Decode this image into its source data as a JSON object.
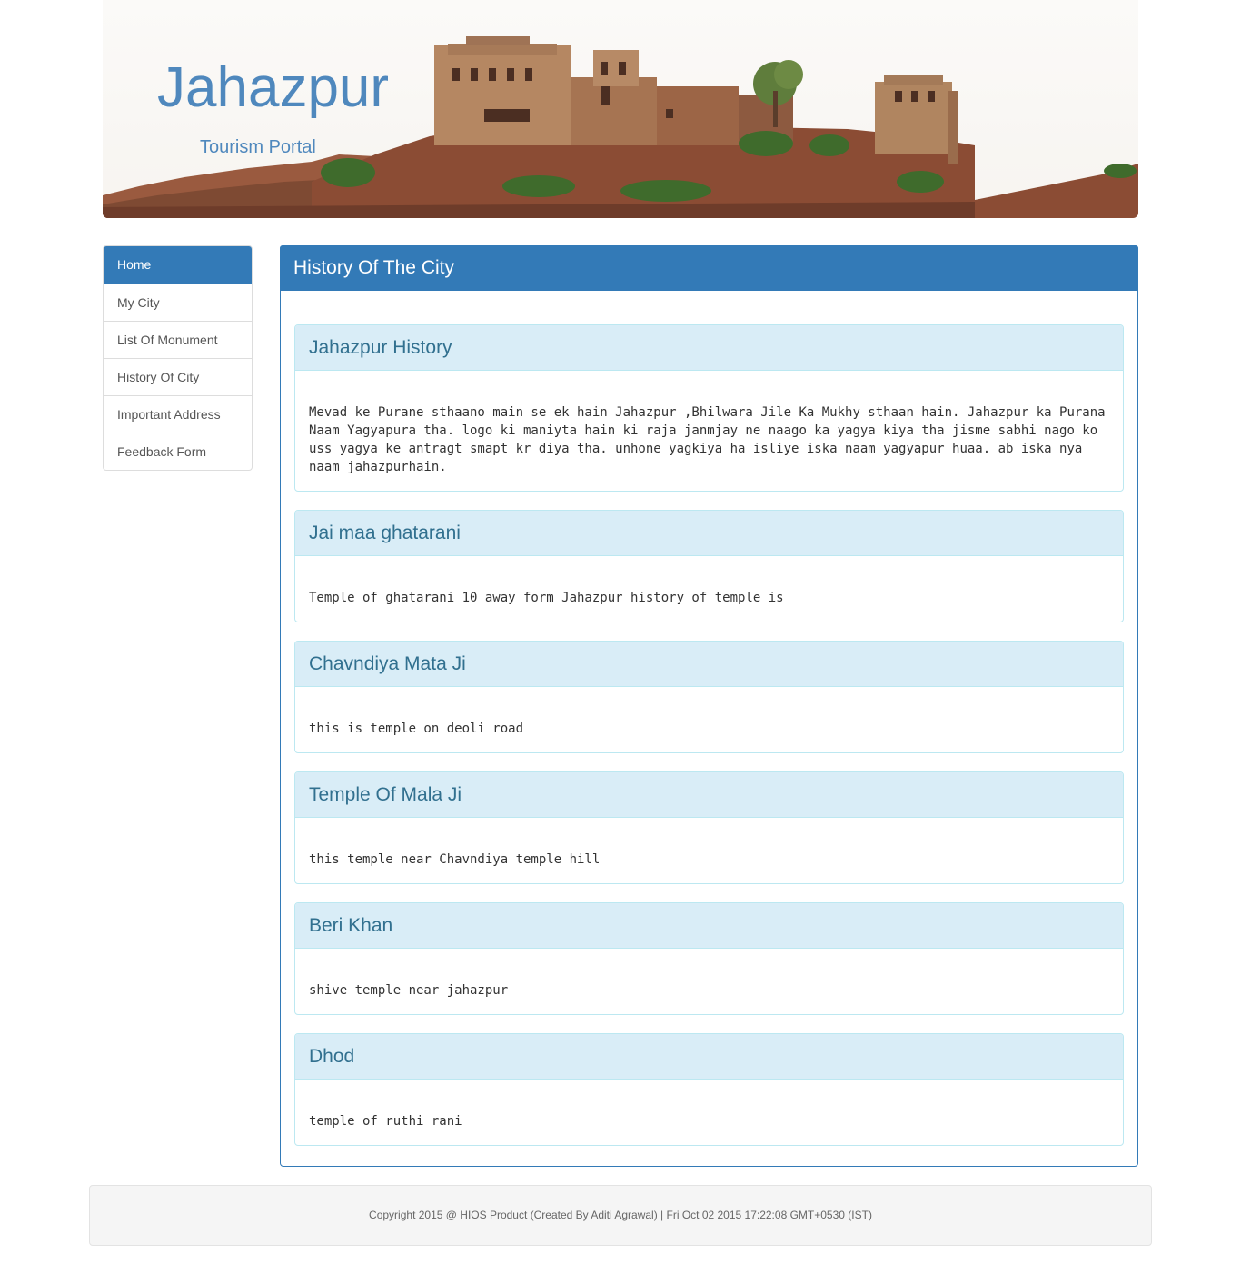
{
  "header": {
    "title": "Jahazpur",
    "subtitle": "Tourism Portal"
  },
  "sidebar": {
    "items": [
      {
        "label": "Home",
        "active": true
      },
      {
        "label": "My City",
        "active": false
      },
      {
        "label": "List Of Monument",
        "active": false
      },
      {
        "label": "History Of City",
        "active": false
      },
      {
        "label": "Important Address",
        "active": false
      },
      {
        "label": "Feedback Form",
        "active": false
      }
    ]
  },
  "main": {
    "heading": "History Of The City",
    "sections": [
      {
        "title": "Jahazpur History",
        "body": "Mevad ke Purane sthaano main se ek hain Jahazpur ,Bhilwara Jile Ka Mukhy sthaan hain. Jahazpur ka Purana Naam Yagyapura tha. logo ki maniyta hain ki raja janmjay ne naago ka yagya kiya tha jisme sabhi nago ko uss yagya ke antragt smapt kr diya tha. unhone yagkiya ha isliye iska naam yagyapur huaa. ab iska nya naam jahazpurhain."
      },
      {
        "title": "Jai maa ghatarani",
        "body": "Temple of ghatarani 10 away form Jahazpur history of temple is"
      },
      {
        "title": "Chavndiya Mata Ji",
        "body": "this is temple on deoli road"
      },
      {
        "title": "Temple Of Mala Ji",
        "body": "this temple near Chavndiya temple hill"
      },
      {
        "title": "Beri Khan",
        "body": "shive temple near jahazpur"
      },
      {
        "title": "Dhod",
        "body": "temple of ruthi rani"
      }
    ]
  },
  "footer": {
    "text": "Copyright 2015 @ HIOS Product (Created By Aditi Agrawal) | Fri Oct 02 2015 17:22:08 GMT+0530 (IST)"
  },
  "colors": {
    "primary": "#337ab7",
    "title_blue": "#4f88bd",
    "info_bg": "#d9edf7",
    "info_border": "#bce8f1",
    "info_text": "#31708f",
    "footer_bg": "#f5f5f5"
  }
}
